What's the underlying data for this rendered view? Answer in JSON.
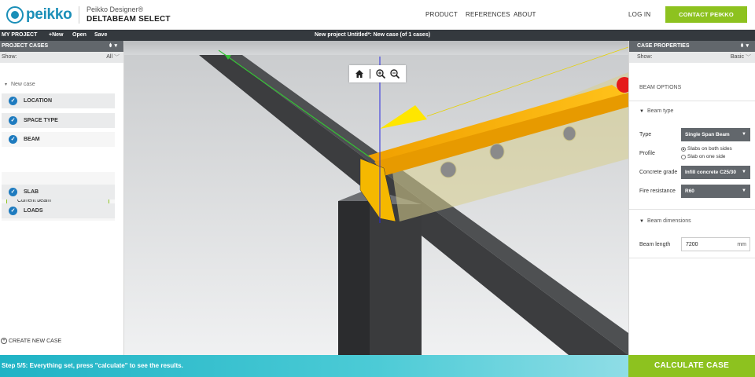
{
  "header": {
    "logo": "peikko",
    "brand_sub": "Peikko Designer®",
    "brand_main": "DELTABEAM SELECT",
    "nav": [
      "PRODUCT",
      "REFERENCES",
      "ABOUT"
    ],
    "login": "LOG IN",
    "contact": "CONTACT PEIKKO"
  },
  "project_bar": {
    "title": "MY PROJECT",
    "actions": [
      "+New",
      "Open",
      "Save"
    ],
    "status": "New project Untitled*: New case (of 1 cases)"
  },
  "left_panel": {
    "title": "PROJECT CASES",
    "control_icon": "pin-icon",
    "show_label": "Show:",
    "show_value": "All",
    "case_name": "New case",
    "steps": [
      "LOCATION",
      "SPACE TYPE",
      "BEAM",
      "SLAB",
      "LOADS"
    ],
    "current_beam": "Current beam",
    "create_new_case": "CREATE NEW CASE"
  },
  "viewport": {
    "toolbar_icons": [
      "home-icon",
      "zoom-in-icon",
      "zoom-out-icon"
    ]
  },
  "right_panel": {
    "title": "CASE PROPERTIES",
    "show_label": "Show:",
    "show_value": "Basic",
    "section": "BEAM OPTIONS",
    "beam_type_header": "Beam type",
    "type_label": "Type",
    "type_value": "Single Span Beam",
    "profile_label": "Profile",
    "profile_options": [
      "Slabs on both sides",
      "Slab on one side"
    ],
    "profile_selected": "Slabs on both sides",
    "concrete_label": "Concrete grade",
    "concrete_value": "Infill concrete C25/30",
    "fire_label": "Fire resistance",
    "fire_value": "R60",
    "dimensions_header": "Beam dimensions",
    "length_label": "Beam length",
    "length_value": "7200",
    "length_unit": "mm"
  },
  "footer": {
    "status": "Step 5/5: Everything set, press \"calculate\" to see the results.",
    "calculate": "CALCULATE CASE"
  },
  "colors": {
    "accent_green": "#8dc21f",
    "brand_blue": "#1b8fb8",
    "dark_bar": "#34393e",
    "panel_gray": "#62676c",
    "teal": "#1fb3c5",
    "beam_yellow": "#f5b800"
  }
}
